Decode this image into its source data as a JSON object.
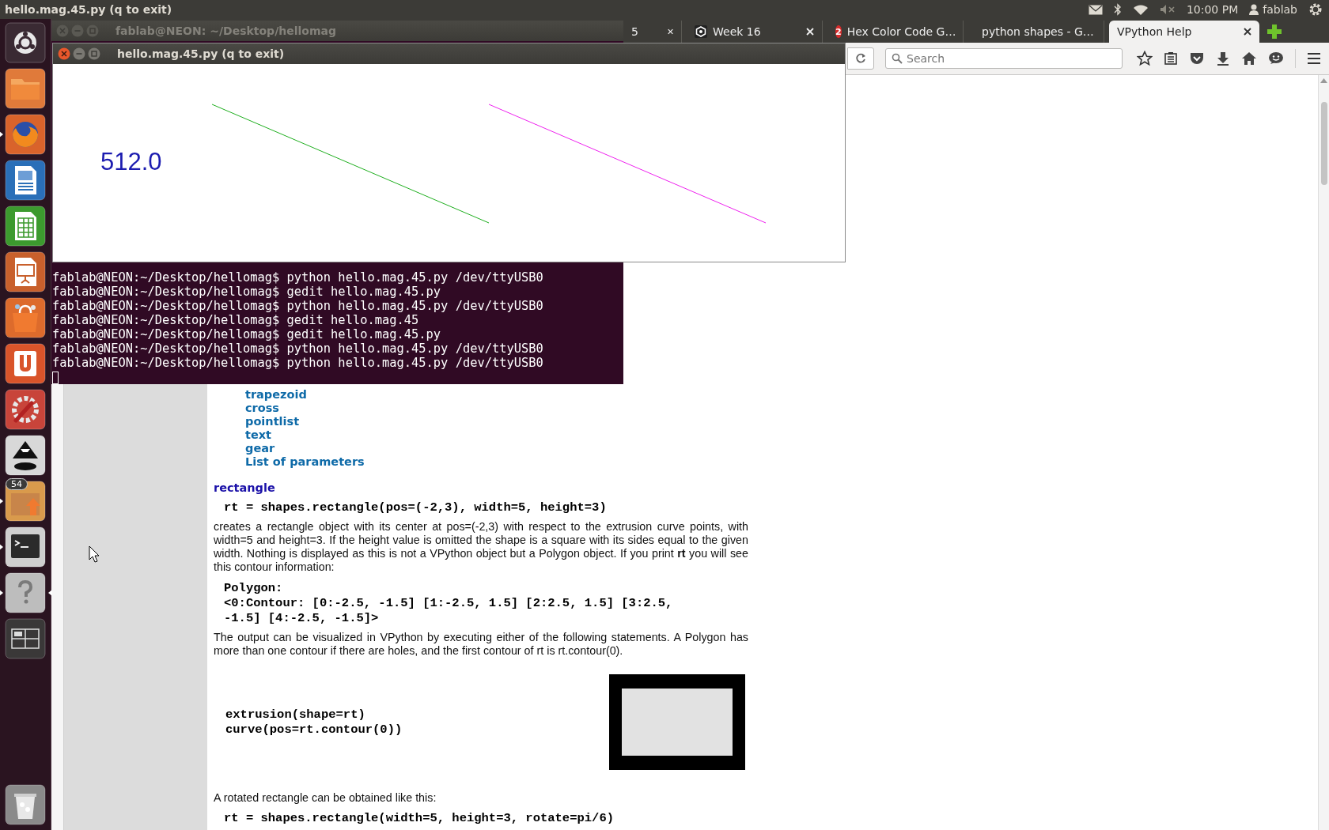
{
  "top_panel": {
    "title": "hello.mag.45.py (q to exit)",
    "volume_muted": true,
    "clock": "10:00 PM",
    "user": "fablab"
  },
  "launcher": [
    {
      "kind": "dash",
      "running": false,
      "focused": false
    },
    {
      "kind": "files",
      "running": false,
      "focused": false
    },
    {
      "kind": "firefox",
      "running": true,
      "focused": false
    },
    {
      "kind": "writer",
      "running": false,
      "focused": false
    },
    {
      "kind": "calc",
      "running": false,
      "focused": false
    },
    {
      "kind": "impress",
      "running": false,
      "focused": false
    },
    {
      "kind": "software",
      "running": false,
      "focused": false
    },
    {
      "kind": "ubuntu-one",
      "running": false,
      "focused": false
    },
    {
      "kind": "settings",
      "running": false,
      "focused": false
    },
    {
      "kind": "inkscape",
      "running": false,
      "focused": false
    },
    {
      "kind": "archive",
      "running": true,
      "focused": false,
      "badge": "54"
    },
    {
      "kind": "terminal",
      "running": true,
      "focused": false
    },
    {
      "kind": "help",
      "running": true,
      "focused": true
    },
    {
      "kind": "workspaces",
      "running": false,
      "focused": false
    },
    {
      "kind": "trash",
      "running": false,
      "focused": false
    }
  ],
  "browser": {
    "tabs": [
      {
        "kind": "plain",
        "label": "5",
        "selected": false
      },
      {
        "kind": "hexagon",
        "label": "Week 16",
        "selected": false
      },
      {
        "kind": "badge",
        "badge": "2",
        "label": "Hex Color Code G…",
        "selected": false
      },
      {
        "kind": "g",
        "label": "python shapes - G…",
        "selected": false
      },
      {
        "kind": "plain",
        "label": "VPython Help",
        "selected": true
      }
    ],
    "search": {
      "placeholder": "Search"
    },
    "page": {
      "links": [
        "trapezoid",
        "cross",
        "pointlist",
        "text",
        "gear",
        "List of parameters"
      ],
      "heading": "rectangle",
      "code_1": "rt = shapes.rectangle(pos=(-2,3), width=5, height=3)",
      "paragraph_1": "creates a rectangle object with its center at pos=(-2,3) with respect to the extrusion curve points, with width=5 and height=3. If the height value is omitted the shape is a square with its sides equal to the given width. Nothing is displayed as this is not a VPython object but a Polygon object. If you print **rt** you will see this contour information:",
      "output_lines": [
        "Polygon:",
        "<0:Contour: [0:-2.5, -1.5] [1:-2.5, 1.5] [2:2.5, 1.5] [3:2.5,",
        "-1.5] [4:-2.5, -1.5]>"
      ],
      "paragraph_2": "The output can be visualized in VPython by executing either of the following statements. A Polygon has more than one contour if there are holes, and the first contour of rt is rt.contour(0).",
      "example_lines": [
        "extrusion(shape=rt)",
        "curve(pos=rt.contour(0))"
      ],
      "paragraph_3": "A rotated rectangle can be obtained like this:",
      "code_2": "rt = shapes.rectangle(width=5, height=3, rotate=pi/6)"
    }
  },
  "terminal": {
    "title": "fablab@NEON: ~/Desktop/hellomag",
    "lines": [
      "fablab@NEON:~/Desktop/hellomag$ python hello.mag.45.py /dev/ttyUSB0",
      "fablab@NEON:~/Desktop/hellomag$ gedit hello.mag.45.py",
      "fablab@NEON:~/Desktop/hellomag$ python hello.mag.45.py /dev/ttyUSB0",
      "fablab@NEON:~/Desktop/hellomag$ gedit hello.mag.45",
      "fablab@NEON:~/Desktop/hellomag$ gedit hello.mag.45.py",
      "fablab@NEON:~/Desktop/hellomag$ python hello.mag.45.py /dev/ttyUSB0",
      "fablab@NEON:~/Desktop/hellomag$ python hello.mag.45.py /dev/ttyUSB0"
    ]
  },
  "plot_window": {
    "title": "hello.mag.45.py (q to exit)",
    "reading": "512.0"
  }
}
